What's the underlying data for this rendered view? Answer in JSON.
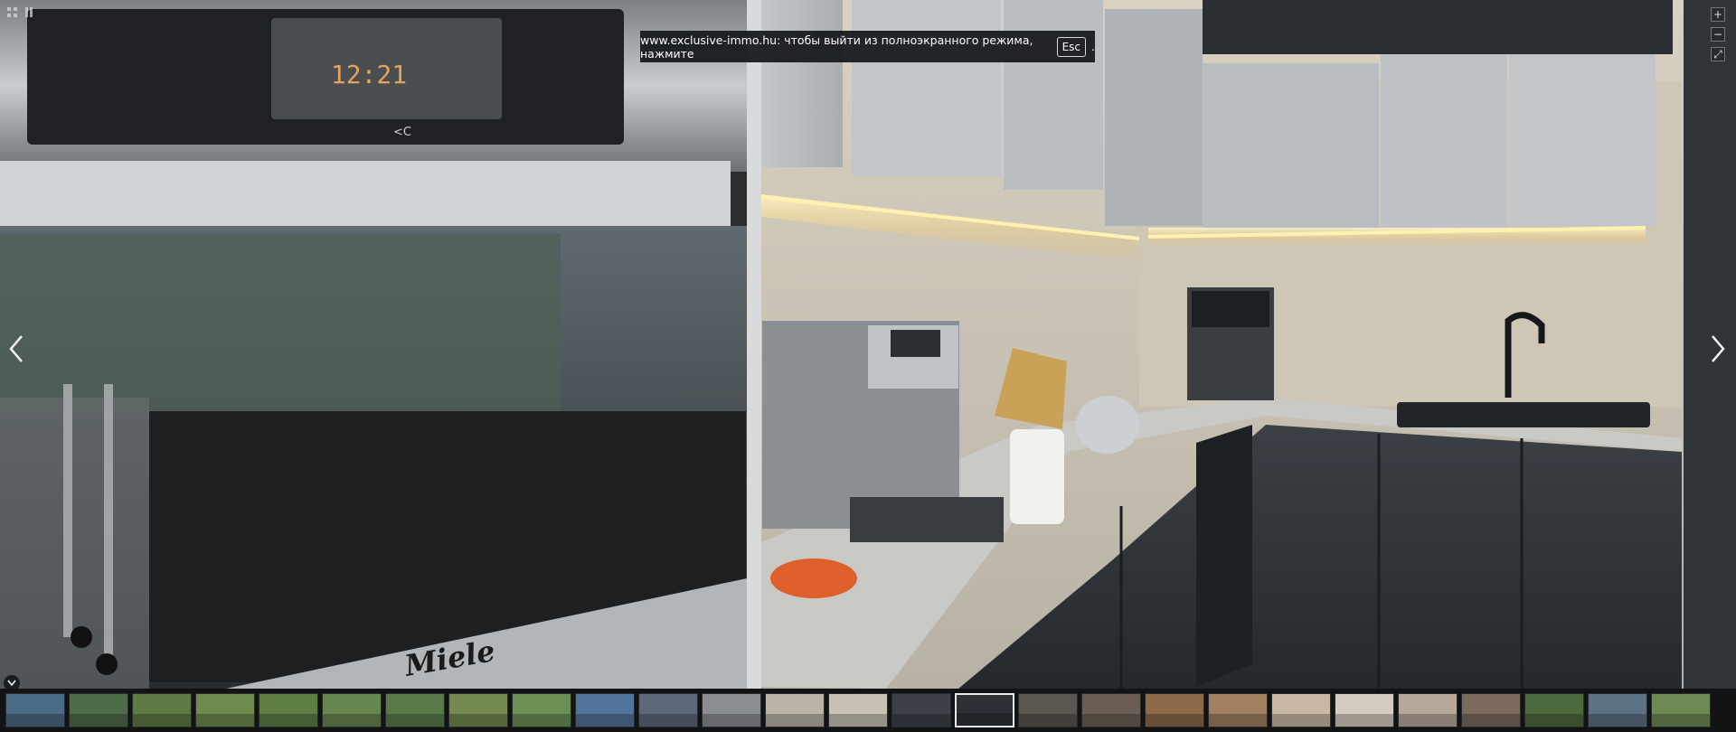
{
  "banner": {
    "text": "www.exclusive-immo.hu: чтобы выйти из полноэкранного режима, нажмите",
    "key": "Esc",
    "suffix": "."
  },
  "scene": {
    "oven_clock": "12:21",
    "oven_button_label": "<C",
    "brand": "Miele"
  },
  "controls": {
    "zoom_in": "+",
    "zoom_out": "−",
    "fullscreen": "⤢"
  },
  "icons": {
    "grid": "grid-icon",
    "pause": "pause-icon",
    "prev": "chevron-left-icon",
    "next": "chevron-right-icon",
    "collapse": "chevron-down-icon"
  },
  "thumbnails": {
    "count": 27,
    "active_index": 15,
    "colors": [
      "#4b6a85",
      "#4f6c4a",
      "#5f7a45",
      "#6e8a4d",
      "#5e7e44",
      "#678650",
      "#5a7a48",
      "#73894f",
      "#6b8f55",
      "#52739a",
      "#5d6878",
      "#8a8d92",
      "#b9b3a8",
      "#c8c2b5",
      "#3d4048",
      "#2d3036",
      "#5a5650",
      "#6b5f55",
      "#8d6a4a",
      "#a08060",
      "#c7b9a6",
      "#d3cbbf",
      "#b6a99a",
      "#7a6b5d",
      "#4d6a3e",
      "#5c7184",
      "#6d8a55"
    ]
  }
}
